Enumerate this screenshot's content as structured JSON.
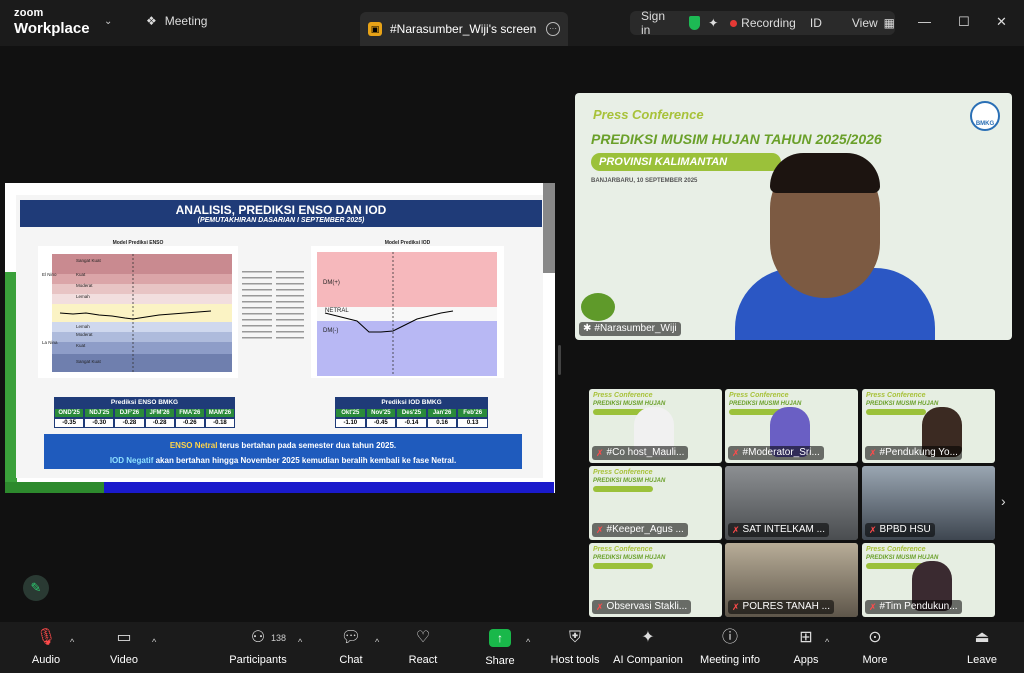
{
  "app": {
    "brand_top": "zoom",
    "brand_bottom": "Workplace"
  },
  "titlebar": {
    "meeting_label": "Meeting",
    "active_tab": "#Narasumber_Wiji's screen",
    "sign_in": "Sign in",
    "recording": "Recording",
    "id_label": "ID",
    "view_label": "View"
  },
  "slide": {
    "title": "ANALISIS, PREDIKSI ENSO DAN IOD",
    "subtitle": "(PEMUTAKHIRAN DASARIAN I SEPTEMBER 2025)",
    "enso_chart_title": "Model Prediksi ENSO",
    "iod_chart_title": "Model Prediksi IOD",
    "enso_labels": [
      "Sangat Kuat",
      "El Nino",
      "Kuat",
      "Moderat",
      "Lemah",
      "Lemah",
      "La Nina",
      "Moderat",
      "Kuat",
      "Sangat Kuat"
    ],
    "iod_labels": [
      "DM(+)",
      "NETRAL",
      "DM(-)"
    ],
    "enso_table": {
      "title": "Prediksi ENSO BMKG",
      "headers": [
        "OND'25",
        "NDJ'25",
        "DJF'26",
        "JFM'26",
        "FMA'26",
        "MAM'26"
      ],
      "values": [
        "-0.35",
        "-0.30",
        "-0.28",
        "-0.28",
        "-0.26",
        "-0.18"
      ]
    },
    "iod_table": {
      "title": "Prediksi IOD BMKG",
      "headers": [
        "Okt'25",
        "Nov'25",
        "Des'25",
        "Jan'26",
        "Feb'26"
      ],
      "values": [
        "-1.10",
        "-0.45",
        "-0.14",
        "0.16",
        "0.13"
      ]
    },
    "summary": {
      "line1_hl": "ENSO Netral",
      "line1_rest": " terus bertahan pada  semester dua tahun 2025.",
      "line2_hl": "IOD Negatif",
      "line2_rest": " akan bertahan hingga November 2025 kemudian beralih kembali ke fase Netral."
    }
  },
  "speaker": {
    "banner1": "Press Conference",
    "banner2": "PREDIKSI MUSIM HUJAN TAHUN 2025/2026",
    "banner3": "PROVINSI KALIMANTAN",
    "date": "BANJARBARU, 10 SEPTEMBER 2025",
    "logo": "BMKG",
    "name": "#Narasumber_Wiji"
  },
  "gallery": [
    {
      "name": "#Co host_Mauli..."
    },
    {
      "name": "#Moderator_Sri..."
    },
    {
      "name": "#Pendukung Yo..."
    },
    {
      "name": "#Keeper_Agus ..."
    },
    {
      "name": "SAT INTELKAM ..."
    },
    {
      "name": "BPBD HSU"
    },
    {
      "name": "Observasi Stakli..."
    },
    {
      "name": "POLRES TANAH ..."
    },
    {
      "name": "#Tim Pendukun..."
    }
  ],
  "toolbar": {
    "audio": "Audio",
    "video": "Video",
    "participants": "Participants",
    "participants_count": "138",
    "chat": "Chat",
    "react": "React",
    "share": "Share",
    "host_tools": "Host tools",
    "ai_companion": "AI Companion",
    "meeting_info": "Meeting info",
    "apps": "Apps",
    "more": "More",
    "leave": "Leave"
  }
}
